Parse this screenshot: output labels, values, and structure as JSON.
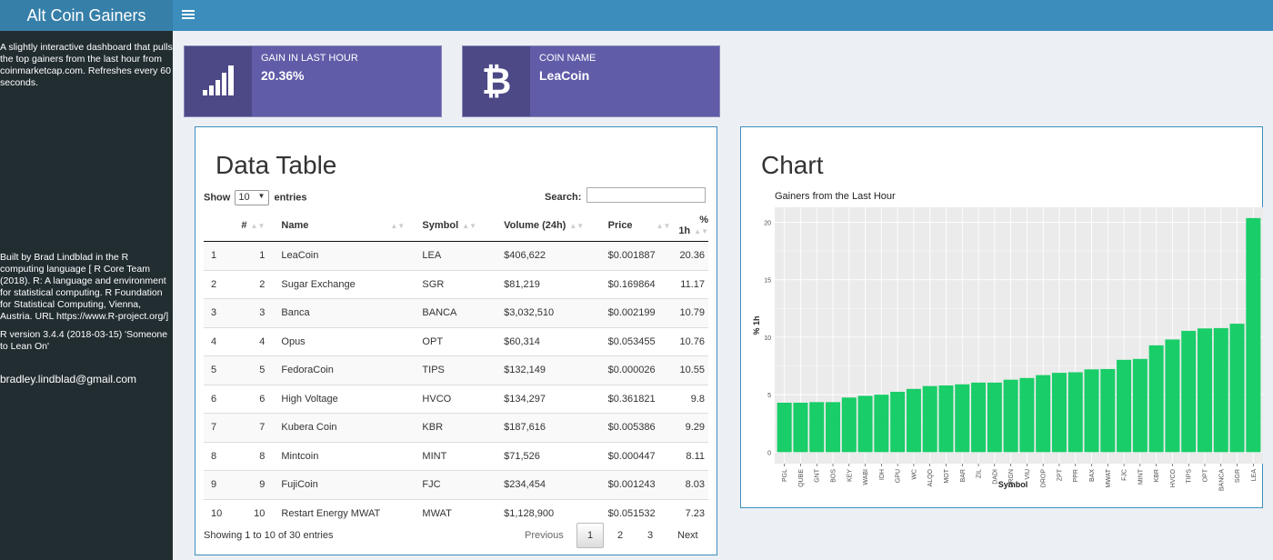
{
  "header": {
    "title": "Alt Coin Gainers"
  },
  "sidebar": {
    "description": "A slightly interactive dashboard that pulls the top gainers from the last hour from coinmarketcap.com. Refreshes every 60 seconds.",
    "credits": "Built by Brad Lindblad in the R computing language [ R Core Team (2018). R: A language and environment for statistical computing. R Foundation for Statistical Computing, Vienna, Austria. URL https://www.R-project.org/]",
    "r_version": "R version 3.4.4 (2018-03-15) 'Someone to Lean On'",
    "email": "bradley.lindblad@gmail.com"
  },
  "value_boxes": [
    {
      "label": "GAIN IN LAST HOUR",
      "value": "20.36%",
      "icon": "signal-bars-icon"
    },
    {
      "label": "COIN NAME",
      "value": "LeaCoin",
      "icon": "bitcoin-icon"
    }
  ],
  "table_box": {
    "title": "Data Table",
    "show_label": "Show",
    "entries_label": "entries",
    "page_length": "10",
    "search_label": "Search:",
    "search_value": "",
    "columns": [
      "",
      "#",
      "Name",
      "Symbol",
      "Volume (24h)",
      "Price",
      "% 1h"
    ],
    "rows": [
      [
        "1",
        "1",
        "LeaCoin",
        "LEA",
        "$406,622",
        "$0.001887",
        "20.36"
      ],
      [
        "2",
        "2",
        "Sugar Exchange",
        "SGR",
        "$81,219",
        "$0.169864",
        "11.17"
      ],
      [
        "3",
        "3",
        "Banca",
        "BANCA",
        "$3,032,510",
        "$0.002199",
        "10.79"
      ],
      [
        "4",
        "4",
        "Opus",
        "OPT",
        "$60,314",
        "$0.053455",
        "10.76"
      ],
      [
        "5",
        "5",
        "FedoraCoin",
        "TIPS",
        "$132,149",
        "$0.000026",
        "10.55"
      ],
      [
        "6",
        "6",
        "High Voltage",
        "HVCO",
        "$134,297",
        "$0.361821",
        "9.8"
      ],
      [
        "7",
        "7",
        "Kubera Coin",
        "KBR",
        "$187,616",
        "$0.005386",
        "9.29"
      ],
      [
        "8",
        "8",
        "Mintcoin",
        "MINT",
        "$71,526",
        "$0.000447",
        "8.11"
      ],
      [
        "9",
        "9",
        "FujiCoin",
        "FJC",
        "$234,454",
        "$0.001243",
        "8.03"
      ],
      [
        "10",
        "10",
        "Restart Energy MWAT",
        "MWAT",
        "$1,128,900",
        "$0.051532",
        "7.23"
      ]
    ],
    "info": "Showing 1 to 10 of 30 entries",
    "pagination": {
      "previous": "Previous",
      "pages": [
        "1",
        "2",
        "3"
      ],
      "current": "1",
      "next": "Next"
    }
  },
  "chart_box": {
    "title": "Chart"
  },
  "chart_data": {
    "type": "bar",
    "title": "Gainers from the Last Hour",
    "xlabel": "Symbol",
    "ylabel": "% 1h",
    "ylim": [
      0,
      21
    ],
    "yticks": [
      0,
      5,
      10,
      15,
      20
    ],
    "grid": true,
    "categories": [
      "PGL",
      "QUBE",
      "GNT",
      "BOS",
      "KEY",
      "WABI",
      "IDH",
      "GPU",
      "WC",
      "ALQO",
      "MOT",
      "BAR",
      "ZIL",
      "DADI",
      "DRGN",
      "VIU",
      "DROP",
      "ZPT",
      "PPR",
      "BAX",
      "MWAT",
      "FJC",
      "MINT",
      "KBR",
      "HVCO",
      "TIPS",
      "OPT",
      "BANCA",
      "SGR",
      "LEA"
    ],
    "values": [
      4.3,
      4.3,
      4.35,
      4.35,
      4.75,
      4.9,
      5.0,
      5.25,
      5.5,
      5.75,
      5.8,
      5.9,
      6.05,
      6.05,
      6.3,
      6.45,
      6.7,
      6.9,
      6.95,
      7.2,
      7.23,
      8.03,
      8.11,
      9.29,
      9.8,
      10.55,
      10.76,
      10.79,
      11.17,
      20.36
    ],
    "colors": {
      "bar": "#19cd68",
      "panel": "#ebebeb",
      "grid": "#ffffff"
    }
  },
  "colors": {
    "header": "#3c8dbc",
    "logo": "#367fa9",
    "sidebar": "#222d32",
    "value_box": "#605ca8",
    "background": "#ecf0f5"
  }
}
